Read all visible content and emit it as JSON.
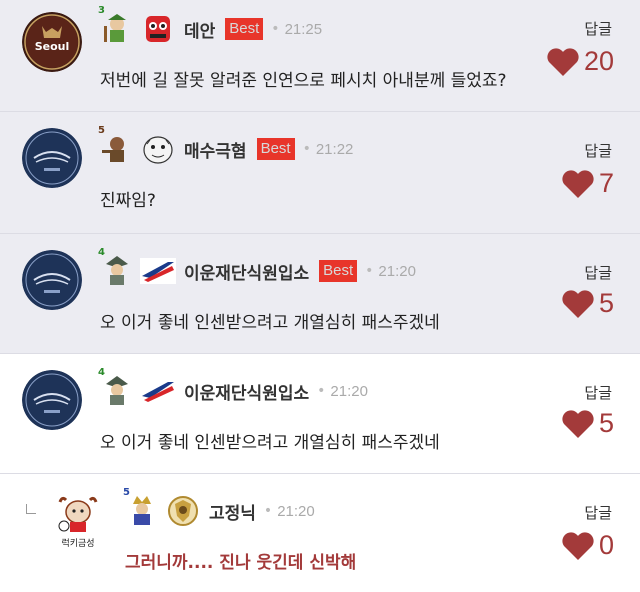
{
  "reply_label": "답글",
  "best_label": "Best",
  "comments": [
    {
      "nickname": "데안",
      "level": "3",
      "time": "21:25",
      "text": "저번에 길 잘못 알려준 인연으로 페시치 아내분께 들었죠?",
      "likes": "20",
      "avatar": "Seoul"
    },
    {
      "nickname": "매수극혐",
      "level": "5",
      "time": "21:22",
      "text": "진짜임?",
      "likes": "7"
    },
    {
      "nickname": "이운재단식원입소",
      "level": "4",
      "time": "21:20",
      "text": "오 이거 좋네 인센받으려고 개열심히 패스주겠네",
      "likes": "5"
    },
    {
      "nickname": "이운재단식원입소",
      "level": "4",
      "time": "21:20",
      "text": "오 이거 좋네 인센받으려고 개열심히 패스주겠네",
      "likes": "5"
    },
    {
      "nickname": "고정닉",
      "level": "5",
      "time": "21:20",
      "text": "그러니까.... 진나 웃긴데 신박해",
      "likes": "0",
      "avatar_caption": "럭키금성"
    }
  ]
}
